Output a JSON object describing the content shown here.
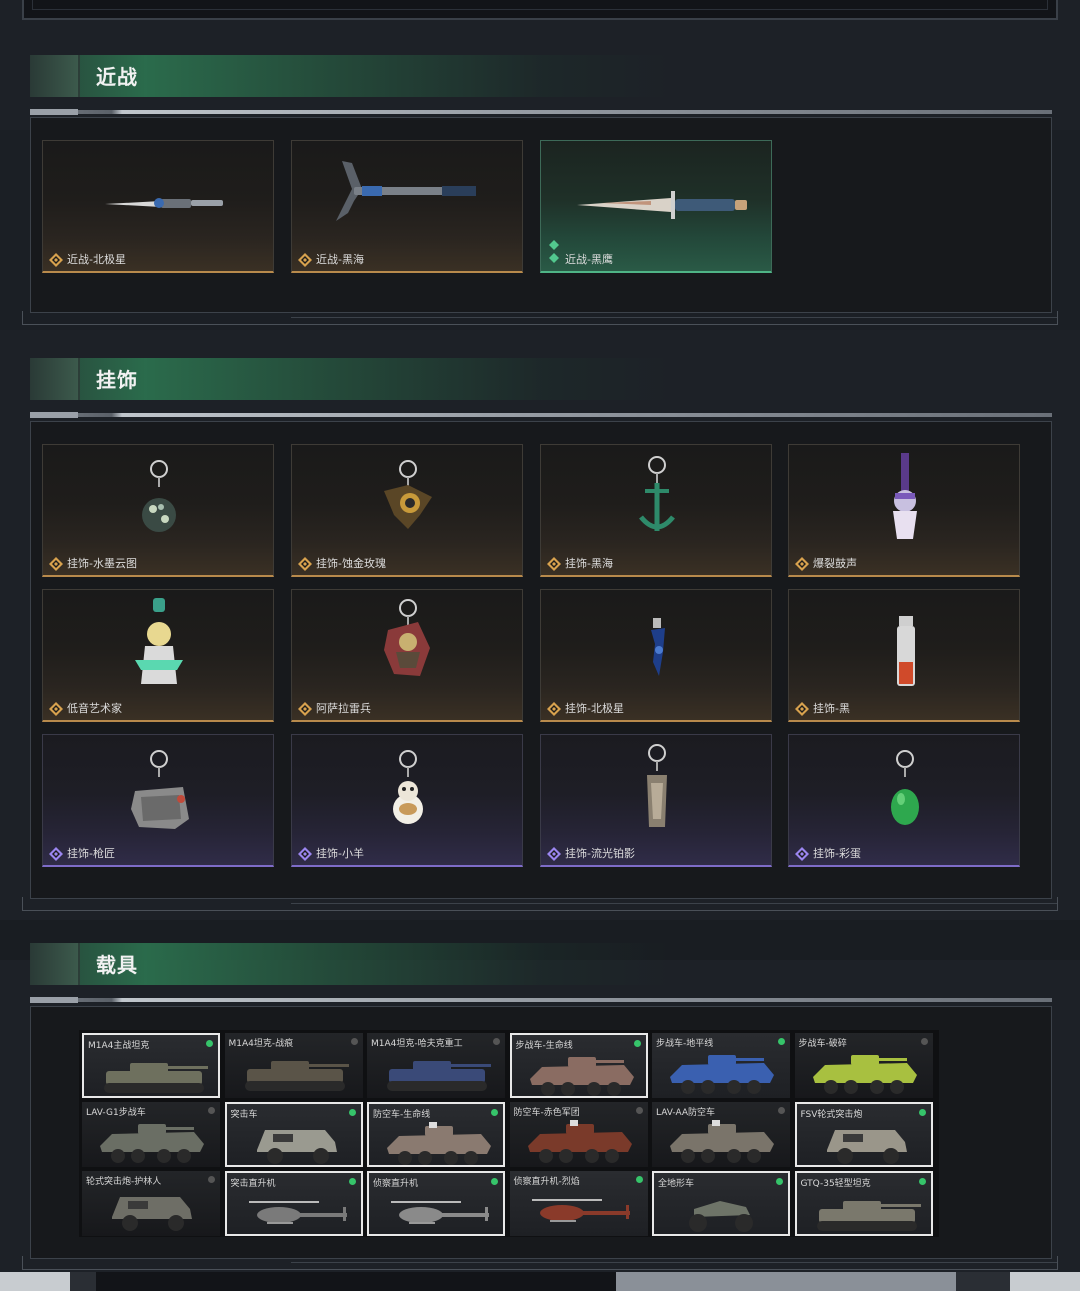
{
  "sections": {
    "melee": {
      "title": "近战"
    },
    "charms": {
      "title": "挂饰"
    },
    "vehicles": {
      "title": "载具"
    }
  },
  "melee_items": [
    {
      "label": "近战-北极星",
      "rarity": "orange"
    },
    {
      "label": "近战-黑海",
      "rarity": "orange"
    },
    {
      "label": "近战-黑鹰",
      "rarity": "green"
    }
  ],
  "charm_items": [
    {
      "label": "挂饰-水墨云图",
      "rarity": "orange"
    },
    {
      "label": "挂饰-蚀金玫瑰",
      "rarity": "orange"
    },
    {
      "label": "挂饰-黑海",
      "rarity": "orange"
    },
    {
      "label": "爆裂鼓声",
      "rarity": "orange"
    },
    {
      "label": "低音艺术家",
      "rarity": "orange"
    },
    {
      "label": "阿萨拉雷兵",
      "rarity": "orange"
    },
    {
      "label": "挂饰-北极星",
      "rarity": "orange"
    },
    {
      "label": "挂饰-黑",
      "rarity": "orange"
    },
    {
      "label": "挂饰-枪匠",
      "rarity": "purple"
    },
    {
      "label": "挂饰-小羊",
      "rarity": "purple"
    },
    {
      "label": "挂饰-流光铂影",
      "rarity": "purple"
    },
    {
      "label": "挂饰-彩蛋",
      "rarity": "purple"
    }
  ],
  "vehicle_items": [
    {
      "label": "M1A4主战坦克",
      "selected": true,
      "owned": true,
      "kind": "tank"
    },
    {
      "label": "M1A4坦克-战痕",
      "selected": false,
      "owned": false,
      "kind": "tank"
    },
    {
      "label": "M1A4坦克-哈夫克重工",
      "selected": false,
      "owned": false,
      "kind": "tank"
    },
    {
      "label": "步战车-生命线",
      "selected": true,
      "owned": true,
      "kind": "ifv"
    },
    {
      "label": "步战车-地平线",
      "selected": false,
      "owned": true,
      "kind": "ifv"
    },
    {
      "label": "步战车-破碎",
      "selected": false,
      "owned": false,
      "kind": "ifv"
    },
    {
      "label": "LAV-G1步战车",
      "selected": false,
      "owned": false,
      "kind": "ifv"
    },
    {
      "label": "突击车",
      "selected": true,
      "owned": true,
      "kind": "truck"
    },
    {
      "label": "防空车-生命线",
      "selected": true,
      "owned": true,
      "kind": "aa"
    },
    {
      "label": "防空车-赤色军团",
      "selected": false,
      "owned": false,
      "kind": "aa"
    },
    {
      "label": "LAV-AA防空车",
      "selected": false,
      "owned": false,
      "kind": "aa"
    },
    {
      "label": "FSV轮式突击炮",
      "selected": true,
      "owned": true,
      "kind": "truck"
    },
    {
      "label": "轮式突击炮-护林人",
      "selected": false,
      "owned": false,
      "kind": "truck"
    },
    {
      "label": "突击直升机",
      "selected": true,
      "owned": true,
      "kind": "heli"
    },
    {
      "label": "侦察直升机",
      "selected": true,
      "owned": true,
      "kind": "heli"
    },
    {
      "label": "侦察直升机-烈焰",
      "selected": false,
      "owned": true,
      "kind": "heli"
    },
    {
      "label": "全地形车",
      "selected": true,
      "owned": true,
      "kind": "atv"
    },
    {
      "label": "GTQ-35轻型坦克",
      "selected": true,
      "owned": true,
      "kind": "tank"
    }
  ],
  "colors": {
    "accent_green": "#4fb486",
    "rarity_orange": "#b88a4c",
    "rarity_purple": "#7e6cc8",
    "owned_dot": "#36c46a"
  }
}
